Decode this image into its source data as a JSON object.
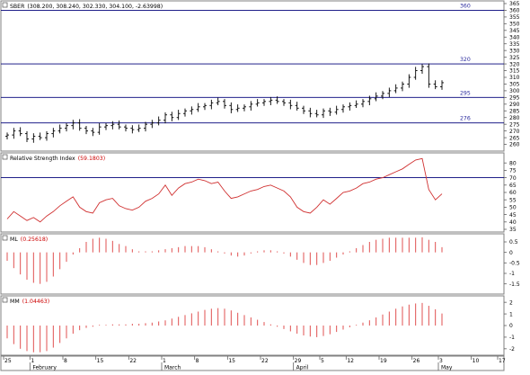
{
  "panels": {
    "price": {
      "title": "SBER",
      "values_text": "(308.200, 308.240, 302.330, 304.100, -2.63998)"
    },
    "rsi": {
      "title": "Relative Strength Index",
      "value": "(59.1803)"
    },
    "ml": {
      "title": "ML",
      "value": "(0.25618)"
    },
    "mm": {
      "title": "MM",
      "value": "(1.04463)"
    }
  },
  "x_axis": {
    "day_ticks": [
      "25",
      "1",
      "8",
      "15",
      "22",
      "1",
      "8",
      "15",
      "22",
      "29",
      "5",
      "12",
      "19",
      "26",
      "3",
      "10",
      "17",
      "24"
    ],
    "months": [
      "February",
      "March",
      "April",
      "May"
    ]
  },
  "colors": {
    "price_bar": "#000000",
    "level_line": "#00007a",
    "level_label": "#2b2b9e",
    "rsi_line": "#d03030",
    "histogram": "#e05050",
    "value_text": "#cc0000"
  },
  "chart_data": [
    {
      "type": "ohlc",
      "title": "SBER",
      "ylim": [
        255,
        367
      ],
      "y_ticks": [
        260,
        265,
        270,
        275,
        280,
        285,
        290,
        295,
        300,
        305,
        310,
        315,
        320,
        325,
        330,
        335,
        340,
        345,
        350,
        355,
        360,
        365
      ],
      "levels": [
        {
          "value": 276,
          "label": "276"
        },
        {
          "value": 295,
          "label": "295"
        },
        {
          "value": 320,
          "label": "320"
        },
        {
          "value": 360,
          "label": "360"
        }
      ],
      "closes": [
        267,
        270,
        268,
        264,
        266,
        265,
        268,
        270,
        272,
        274,
        276,
        272,
        270,
        269,
        273,
        274,
        275,
        273,
        272,
        271,
        272,
        275,
        276,
        278,
        282,
        280,
        283,
        285,
        286,
        288,
        289,
        291,
        292,
        289,
        286,
        287,
        288,
        290,
        291,
        292,
        293,
        292,
        291,
        289,
        287,
        285,
        283,
        282,
        285,
        284,
        286,
        288,
        289,
        290,
        292,
        294,
        296,
        298,
        300,
        302,
        305,
        310,
        315,
        318,
        305,
        303,
        306
      ]
    },
    {
      "type": "line",
      "title": "Relative Strength Index",
      "ylim": [
        35,
        85
      ],
      "y_ticks": [
        35,
        40,
        45,
        50,
        55,
        60,
        65,
        70,
        75,
        80
      ],
      "levels": [
        70
      ],
      "values": [
        42,
        47,
        44,
        41,
        43,
        40,
        44,
        47,
        51,
        54,
        57,
        50,
        47,
        46,
        53,
        55,
        56,
        51,
        49,
        48,
        50,
        54,
        56,
        59,
        65,
        58,
        63,
        66,
        67,
        69,
        68,
        66,
        67,
        61,
        56,
        57,
        59,
        61,
        62,
        64,
        65,
        63,
        61,
        57,
        50,
        47,
        46,
        50,
        55,
        52,
        56,
        60,
        61,
        63,
        66,
        67,
        69,
        70,
        72,
        74,
        76,
        79,
        82,
        83,
        62,
        55,
        59
      ]
    },
    {
      "type": "bar",
      "title": "ML",
      "ylim": [
        -1.9,
        0.8
      ],
      "y_ticks": [
        -1.5,
        -1,
        -0.5,
        0,
        0.5
      ],
      "values": [
        -0.4,
        -0.75,
        -1.05,
        -1.3,
        -1.45,
        -1.5,
        -1.4,
        -1.15,
        -0.8,
        -0.45,
        -0.1,
        0.2,
        0.5,
        0.65,
        0.7,
        0.65,
        0.55,
        0.4,
        0.3,
        0.15,
        0.05,
        0.05,
        0.05,
        0.1,
        0.15,
        0.2,
        0.25,
        0.3,
        0.3,
        0.3,
        0.25,
        0.15,
        0.05,
        -0.05,
        -0.15,
        -0.2,
        -0.15,
        -0.05,
        0.05,
        0.1,
        0.1,
        0.05,
        -0.05,
        -0.2,
        -0.35,
        -0.5,
        -0.6,
        -0.6,
        -0.5,
        -0.4,
        -0.25,
        -0.1,
        0.05,
        0.2,
        0.35,
        0.5,
        0.6,
        0.65,
        0.7,
        0.7,
        0.7,
        0.7,
        0.7,
        0.72,
        0.6,
        0.5,
        0.25
      ]
    },
    {
      "type": "bar",
      "title": "MM",
      "ylim": [
        -2.4,
        2.4
      ],
      "y_ticks": [
        -2,
        -1,
        0,
        1,
        2
      ],
      "values": [
        -1.1,
        -1.6,
        -2.0,
        -2.2,
        -2.3,
        -2.3,
        -2.2,
        -1.9,
        -1.5,
        -1.1,
        -0.7,
        -0.4,
        -0.2,
        -0.1,
        0.0,
        0.05,
        0.1,
        0.1,
        0.1,
        0.15,
        0.15,
        0.2,
        0.25,
        0.35,
        0.45,
        0.6,
        0.75,
        0.9,
        1.05,
        1.2,
        1.35,
        1.45,
        1.5,
        1.45,
        1.3,
        1.1,
        0.9,
        0.7,
        0.5,
        0.3,
        0.1,
        -0.1,
        -0.3,
        -0.5,
        -0.7,
        -0.85,
        -0.95,
        -1.0,
        -0.9,
        -0.75,
        -0.55,
        -0.35,
        -0.15,
        0.05,
        0.25,
        0.45,
        0.7,
        0.95,
        1.2,
        1.45,
        1.65,
        1.8,
        1.9,
        1.95,
        1.7,
        1.4,
        1.04
      ]
    }
  ]
}
